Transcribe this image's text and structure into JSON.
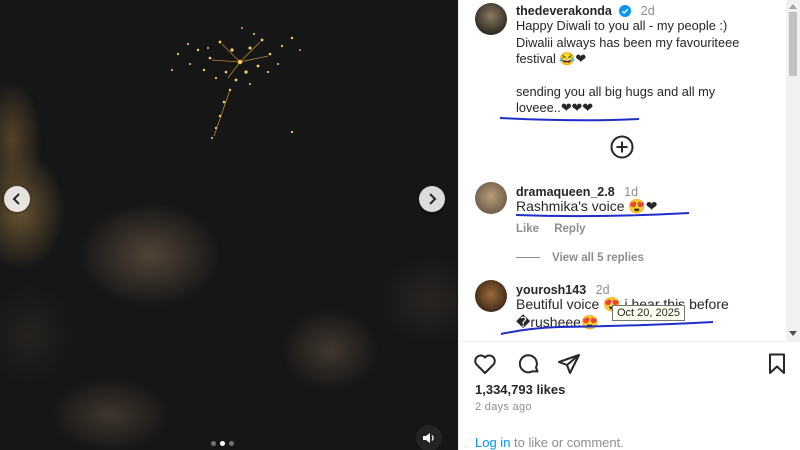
{
  "post": {
    "username": "thedeverakonda",
    "time": "2d",
    "caption_line1": "Happy Diwali to you all - my people :)",
    "caption_line2": "Diwalii always has been my favouriteee",
    "caption_line3": "festival 😂❤",
    "caption_line4": "sending you all big hugs and all my",
    "caption_line5": "loveee..❤❤❤"
  },
  "comments": [
    {
      "username": "dramaqueen_2.8",
      "time": "1d",
      "text": "Rashmika's voice 😍❤",
      "like_label": "Like",
      "reply_label": "Reply",
      "view_replies": "View all 5 replies"
    },
    {
      "username": "yourosh143",
      "time": "2d",
      "text_line1": "Beutiful voice 😍 i hear this before",
      "text_line2": "�rusheee😍",
      "tooltip": "Oct 20, 2025"
    }
  ],
  "footer": {
    "likes": "1,334,793 likes",
    "date": "2 days ago",
    "login_link": "Log in",
    "login_rest": " to like or comment."
  },
  "media": {
    "dots_total": 3,
    "dots_active": 2
  },
  "colors": {
    "link": "#0095f6",
    "verified": "#0095f6",
    "annotation_ink": "#1f2ec8",
    "secondary_text": "#8e8e8e"
  },
  "icons": {
    "like": "heart-icon",
    "comment": "comment-bubble-icon",
    "share": "paper-plane-icon",
    "save": "bookmark-icon",
    "expand": "plus-circle-icon",
    "mute": "speaker-icon"
  }
}
